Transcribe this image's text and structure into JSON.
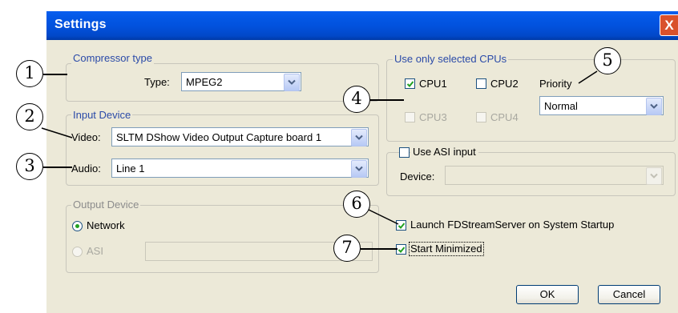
{
  "window": {
    "title": "Settings",
    "close_label": "X"
  },
  "compressor": {
    "legend": "Compressor type",
    "type_label": "Type:",
    "type_value": "MPEG2"
  },
  "input_device": {
    "legend": "Input Device",
    "video_label": "Video:",
    "video_value": "SLTM DShow Video Output Capture board 1",
    "audio_label": "Audio:",
    "audio_value": "Line 1"
  },
  "output_device": {
    "legend": "Output Device",
    "network_label": "Network",
    "network_selected": true,
    "asi_label": "ASI",
    "asi_value": ""
  },
  "cpus": {
    "legend": "Use only selected CPUs",
    "items": [
      {
        "label": "CPU1",
        "checked": true,
        "enabled": true
      },
      {
        "label": "CPU2",
        "checked": false,
        "enabled": true
      },
      {
        "label": "CPU3",
        "checked": false,
        "enabled": false
      },
      {
        "label": "CPU4",
        "checked": false,
        "enabled": false
      }
    ],
    "priority_label": "Priority",
    "priority_value": "Normal"
  },
  "asi_input": {
    "label": "Use ASI input",
    "checked": false,
    "device_label": "Device:",
    "device_value": ""
  },
  "options": {
    "launch_label": "Launch FDStreamServer on System Startup",
    "launch_checked": true,
    "minimized_label": "Start Minimized",
    "minimized_checked": true
  },
  "buttons": {
    "ok": "OK",
    "cancel": "Cancel"
  },
  "callouts": [
    "1",
    "2",
    "3",
    "4",
    "5",
    "6",
    "7"
  ],
  "icons": {
    "close": "close-icon",
    "dropdown": "chevron-down-icon",
    "check": "checkmark-icon"
  }
}
